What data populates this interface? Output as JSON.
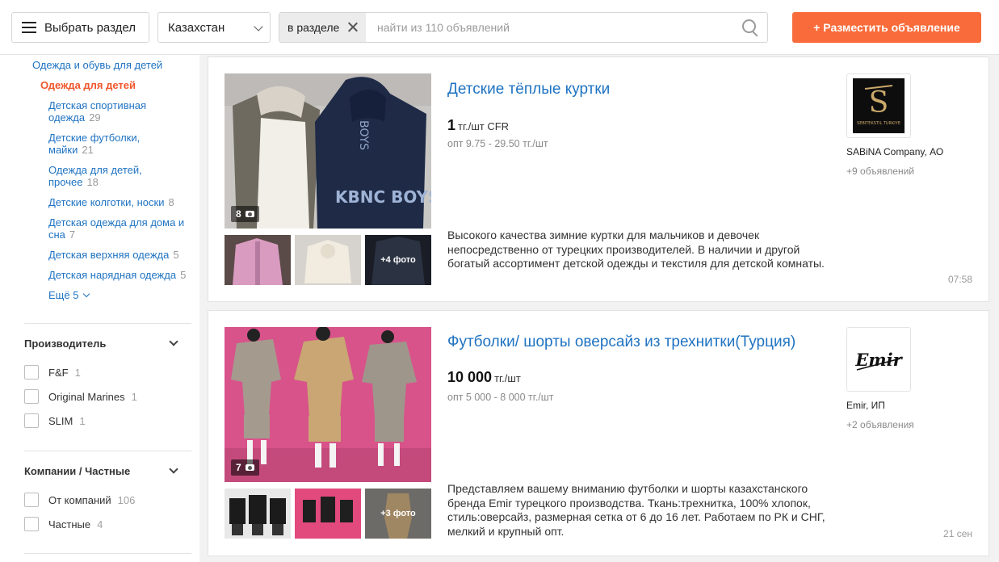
{
  "header": {
    "menu_label": "Выбрать раздел",
    "region": "Казахстан",
    "scope_chip": "в разделе",
    "search_placeholder": "найти из 110 объявлений",
    "post_label": "+ Разместить объявление"
  },
  "sidebar": {
    "parent": "Одежда и обувь для детей",
    "current": "Одежда для детей",
    "subcategories": [
      {
        "label": "Детская спортивная одежда",
        "count": "29"
      },
      {
        "label": "Детские футболки, майки",
        "count": "21"
      },
      {
        "label": "Одежда для детей, прочее",
        "count": "18"
      },
      {
        "label": "Детские колготки, носки",
        "count": "8"
      },
      {
        "label": "Детская одежда для дома и сна",
        "count": "7"
      },
      {
        "label": "Детская верхняя одежда",
        "count": "5"
      },
      {
        "label": "Детская нарядная одежда",
        "count": "5"
      }
    ],
    "more_label": "Ещё 5",
    "filters": [
      {
        "title": "Производитель",
        "options": [
          {
            "label": "F&F",
            "count": "1"
          },
          {
            "label": "Original Marines",
            "count": "1"
          },
          {
            "label": "SLIM",
            "count": "1"
          }
        ]
      },
      {
        "title": "Компании / Частные",
        "options": [
          {
            "label": "От компаний",
            "count": "106"
          },
          {
            "label": "Частные",
            "count": "4"
          }
        ]
      }
    ]
  },
  "listings": [
    {
      "title": "Детские тёплые куртки",
      "price": "1",
      "price_unit": "тг./шт CFR",
      "opt": "опт 9.75 - 29.50 тг./шт",
      "description": "Высокого качества зимние куртки для мальчиков и девочек непосредственно от турецких производителей. В наличии и другой богатый ассортимент детской одежды и текстиля для детской комнаты.",
      "photo_count": "8",
      "more_photos": "+4 фото",
      "seller": "SABiNA Company, АО",
      "seller_more": "+9 объявлений",
      "time": "07:58",
      "logo_text": "SEBITEKSTIL TURKIYE",
      "image_text": "KBNC BOYS",
      "image_text_2": "BOYS"
    },
    {
      "title": "Футболки/ шорты оверсайз из трехнитки(Турция)",
      "price": "10 000",
      "price_unit": "тг./шт",
      "opt": "опт 5 000 - 8 000 тг./шт",
      "description": "Представляем вашему вниманию футболки и шорты казахстанского бренда Emir турецкого производства. Ткань:трехнитка, 100% хлопок, стиль:оверсайз, размерная сетка от 6 до 16 лет. Работаем по РК и СНГ, мелкий и крупный опт.",
      "photo_count": "7",
      "more_photos": "+3 фото",
      "seller": "Emir, ИП",
      "seller_more": "+2 объявления",
      "time": "21 сен",
      "logo_text": "Emir"
    }
  ],
  "colors": {
    "accent": "#f96b3a",
    "link": "#1f73c2",
    "current_category": "#f0572c"
  }
}
